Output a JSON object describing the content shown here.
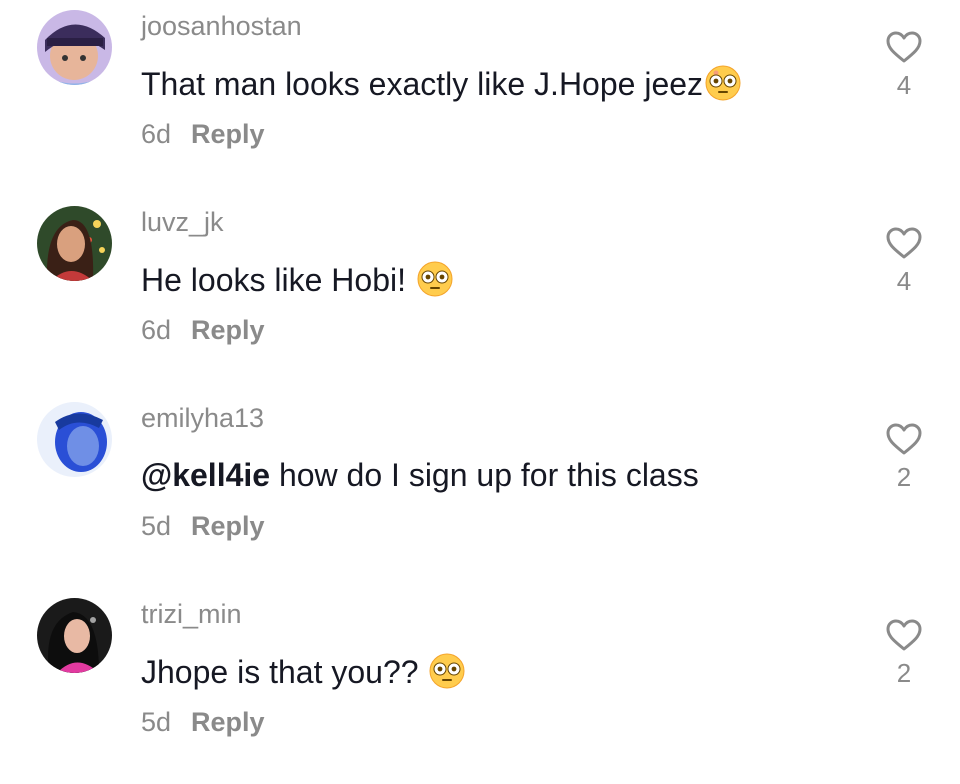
{
  "comments": [
    {
      "username": "joosanhostan",
      "text": "That man looks exactly like J.Hope jeez",
      "time": "6d",
      "reply_label": "Reply",
      "likes": "4"
    },
    {
      "username": "luvz_jk",
      "text": "He looks like Hobi! ",
      "time": "6d",
      "reply_label": "Reply",
      "likes": "4"
    },
    {
      "username": "emilyha13",
      "mention": "@kell4ie",
      "text": " how do I sign up for this class",
      "time": "5d",
      "reply_label": "Reply",
      "likes": "2"
    },
    {
      "username": "trizi_min",
      "text": "Jhope is that you?? ",
      "time": "5d",
      "reply_label": "Reply",
      "likes": "2"
    }
  ],
  "icons": {
    "like": "heart-outline-icon",
    "emoji": "flushed-face-emoji"
  },
  "colors": {
    "text": "#161823",
    "muted": "#8a8a8a",
    "background": "#ffffff"
  }
}
